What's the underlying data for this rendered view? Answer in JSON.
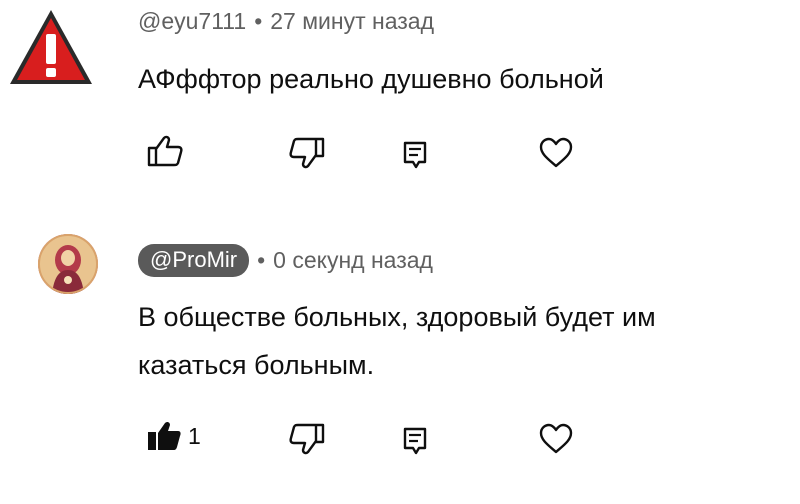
{
  "comments": [
    {
      "handle": "@eyu7111",
      "time": "27 минут назад",
      "separator": "•",
      "text_lines": [
        "АФффтор реально душевно больной"
      ],
      "like_count": "",
      "liked": false,
      "avatar_icon": "warning-icon"
    },
    {
      "handle": "@ProMir",
      "time": "0 секунд назад",
      "separator": "•",
      "text_lines": [
        "В обществе больных, здоровый будет им",
        "казаться больным."
      ],
      "like_count": "1",
      "liked": true,
      "avatar_icon": "avatar-image"
    }
  ],
  "icons": {
    "like": "thumb-up-icon",
    "dislike": "thumb-down-icon",
    "reply": "reply-icon",
    "heart": "heart-icon"
  },
  "colors": {
    "meta": "#606060",
    "pill_bg": "#5a5a5a",
    "text": "#0f0f0f",
    "warning_red": "#d81e1e"
  }
}
